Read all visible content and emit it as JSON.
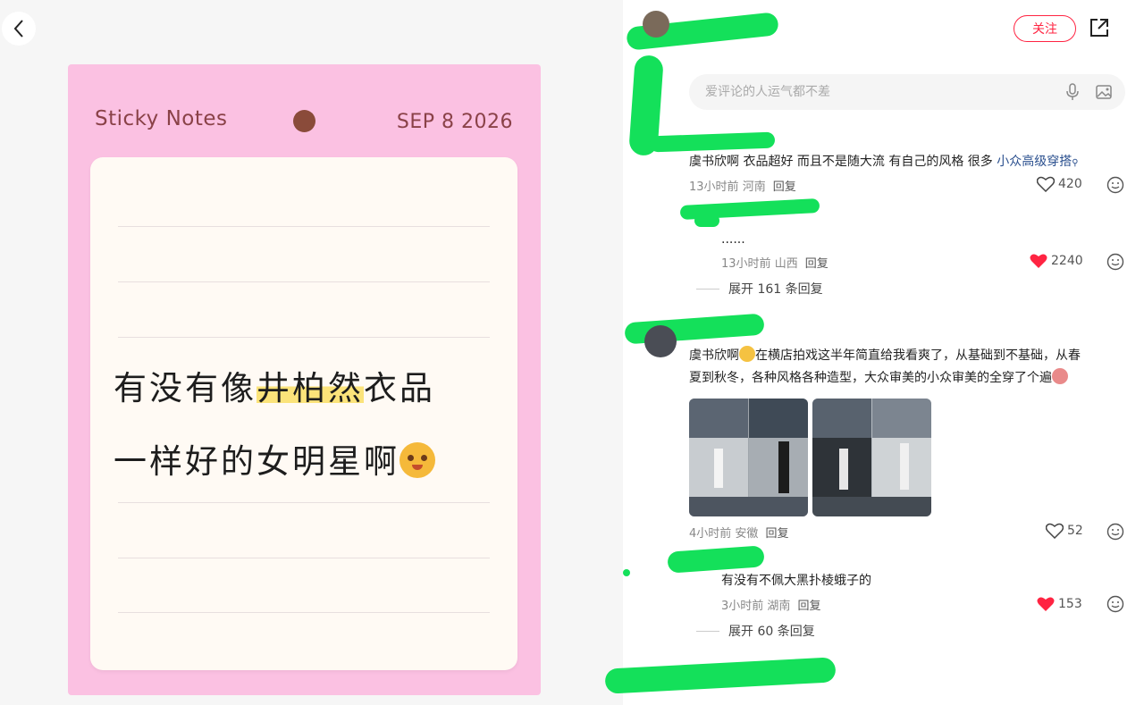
{
  "note": {
    "brand": "Sticky Notes",
    "date": "SEP 8 2026",
    "line1_pre": "有没有像",
    "line1_highlight": "井柏然",
    "line1_post": "衣品",
    "line2": "一样好的女明星啊"
  },
  "header": {
    "follow_label": "关注"
  },
  "search": {
    "placeholder": "爱评论的人运气都不差"
  },
  "comments": [
    {
      "text_pre": "虞书欣啊 衣品超好 而且不是随大流 有自己的风格 很多 ",
      "tag": "小众高级穿搭",
      "time": "13小时前",
      "location": "河南",
      "reply": "回复",
      "likes": "420",
      "liked": false
    },
    {
      "text": "......",
      "time": "13小时前",
      "location": "山西",
      "reply": "回复",
      "likes": "2240",
      "liked": true,
      "expand": "展开 161 条回复"
    },
    {
      "text_line1": "虞书欣啊",
      "text_line1b": "在横店拍戏这半年简直给我看爽了，从基础到不基础，从春",
      "text_line2": "夏到秋冬，各种风格各种造型，大众审美的小众审美的全穿了个遍",
      "time": "4小时前",
      "location": "安徽",
      "reply": "回复",
      "likes": "52",
      "liked": false
    },
    {
      "text": "有没有不佩大黑扑棱蛾子的",
      "time": "3小时前",
      "location": "湖南",
      "reply": "回复",
      "likes": "153",
      "liked": true,
      "expand": "展开 60 条回复"
    }
  ],
  "colors": {
    "accent": "#ff2442",
    "card_pink": "#fbc1e2",
    "note_highlight": "#fbe37a",
    "redaction": "#14e05a"
  }
}
